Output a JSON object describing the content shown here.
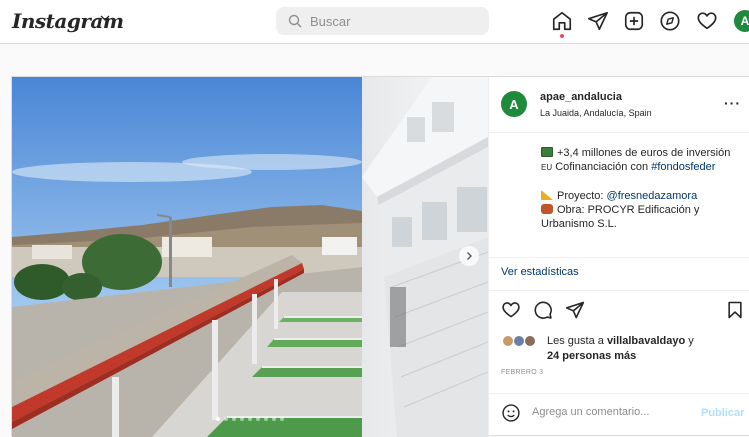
{
  "topbar": {
    "logo": "Instagram",
    "search_placeholder": "Buscar",
    "icons": [
      "home-icon",
      "direct-icon",
      "new-post-icon",
      "explore-icon",
      "activity-icon",
      "profile-avatar"
    ],
    "avatar_letter": "A"
  },
  "post": {
    "username": "apae_andalucia",
    "location": "La Juaida, Andalucía, Spain",
    "avatar_letter": "A",
    "more": "···",
    "caption": {
      "line1": "+3,4 millones de euros de inversión",
      "line2_prefix": "Cofinanciación con ",
      "line2_flag": "EU",
      "line2_tag": "#fondosfeder",
      "proyecto_label": "Proyecto: ",
      "proyecto_mention": "@fresnedazamora",
      "obra": "Obra: PROCYR Edificación y Urbanismo S.L."
    },
    "stats_link": "Ver estadísticas",
    "likes": {
      "prefix": "Les gusta a ",
      "user": "villalbavaldayo",
      "middle": " y ",
      "others": "24 personas más"
    },
    "date": "FEBRERO 3",
    "comment_placeholder": "Agrega un comentario...",
    "publish": "Publicar",
    "carousel": {
      "total": 9,
      "active_index": 0
    }
  },
  "colors": {
    "brand_green": "#1e8a3c",
    "link": "#00376b",
    "notification": "#ed4956",
    "publish_disabled": "#b2dffc"
  }
}
